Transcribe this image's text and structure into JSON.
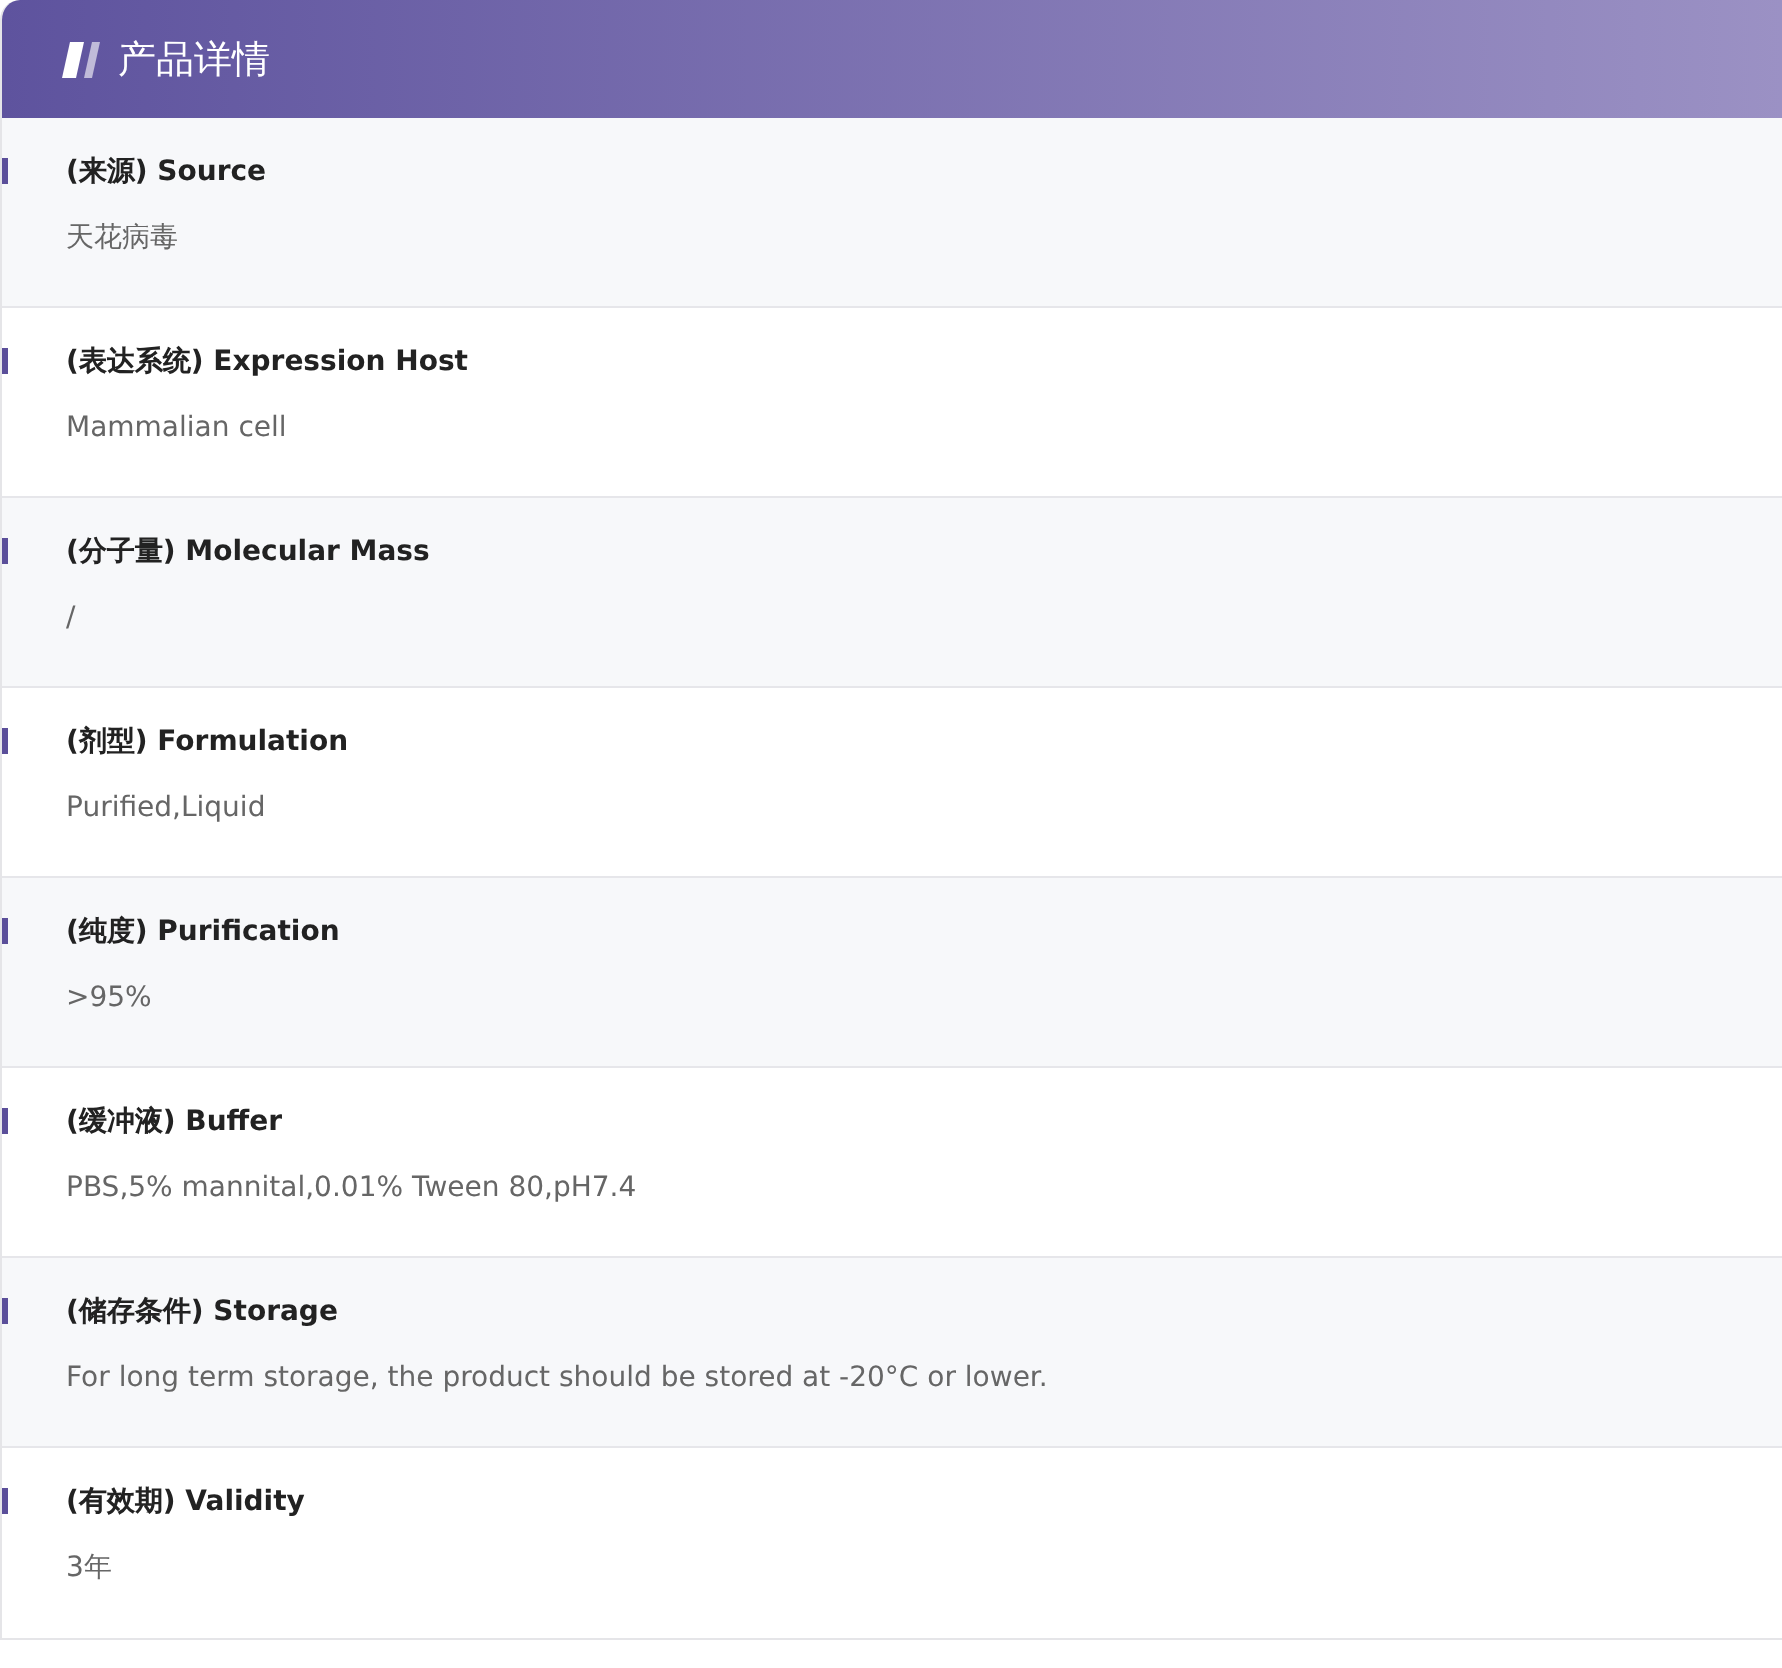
{
  "header": {
    "title": "产品详情"
  },
  "items": [
    {
      "label": "(来源) Source",
      "value": "天花病毒"
    },
    {
      "label": "(表达系统) Expression Host",
      "value": "Mammalian cell"
    },
    {
      "label": "(分子量) Molecular Mass",
      "value": "/"
    },
    {
      "label": "(剂型) Formulation",
      "value": "Purified,Liquid"
    },
    {
      "label": "(纯度) Purification",
      "value": ">95%"
    },
    {
      "label": "(缓冲液) Buffer",
      "value": "PBS,5% mannital,0.01% Tween 80,pH7.4"
    },
    {
      "label": "(储存条件) Storage",
      "value": "For long term storage, the product should be stored at -20°C or lower."
    },
    {
      "label": "(有效期) Validity",
      "value": "3年"
    }
  ]
}
